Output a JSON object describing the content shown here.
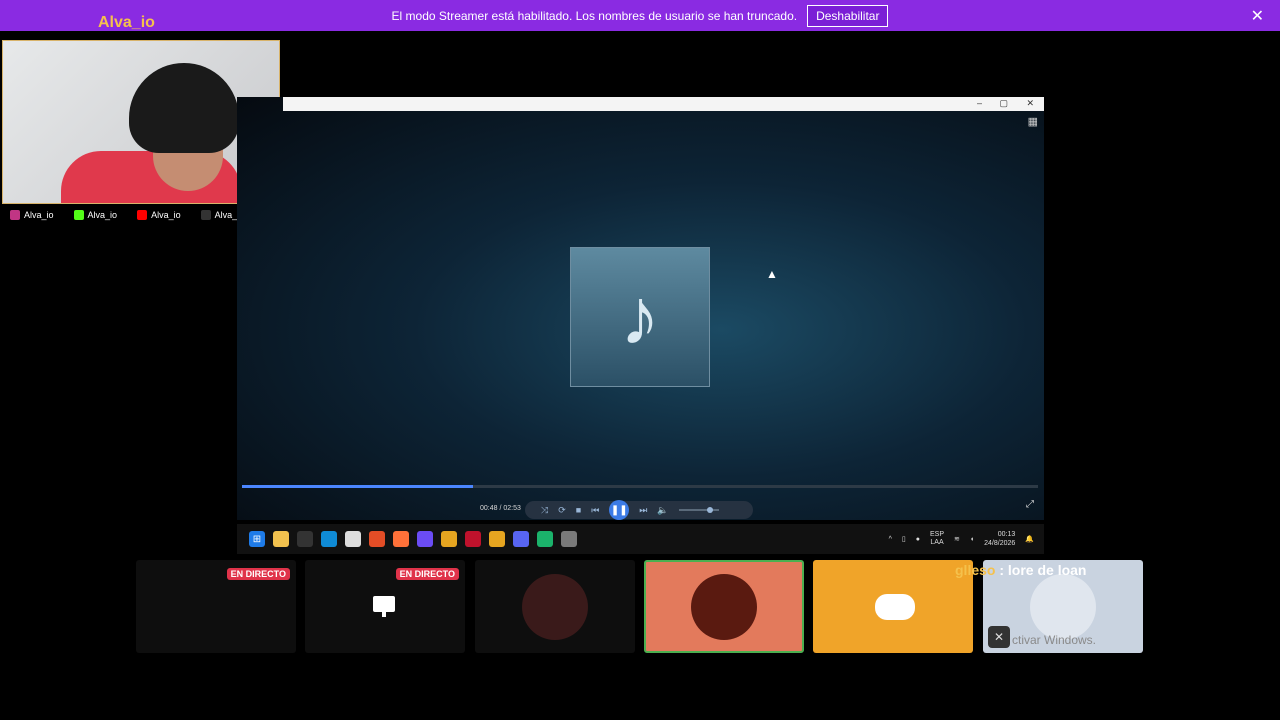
{
  "banner": {
    "message": "El modo Streamer está habilitado. Los nombres de usuario se han truncado.",
    "button": "Deshabilitar",
    "close": "✕"
  },
  "webcam": {
    "name": "Alva_io",
    "socials": [
      {
        "handle": "Alva_io",
        "icon": "instagram-icon",
        "color": "#c13584"
      },
      {
        "handle": "Alva_io",
        "icon": "kick-icon",
        "color": "#53fc18"
      },
      {
        "handle": "Alva_io",
        "icon": "youtube-icon",
        "color": "#ff0000"
      },
      {
        "handle": "Alva_io",
        "icon": "tiktok-icon",
        "color": "#000000"
      }
    ]
  },
  "player": {
    "window_buttons": [
      "–",
      "▢",
      "✕"
    ],
    "time": "00:48 / 02:53",
    "progress": 0.29,
    "play_state": "paused-icon"
  },
  "taskbar": {
    "lang_top": "ESP",
    "lang_bottom": "LAA",
    "time": "00:13",
    "date": "24/8/2026"
  },
  "tiles": {
    "live_label_1": "EN DIRECTO",
    "live_label_2": "EN DIRECTO",
    "chat_user": "glleso",
    "chat_message": " : lore de loan",
    "activate_text": "ctivar Windows."
  },
  "colors": {
    "banner": "#8a2be2",
    "accent": "#f5c14c",
    "live": "#e0334a",
    "discord": "#f0a429",
    "tile_active": "#e37a5c"
  }
}
